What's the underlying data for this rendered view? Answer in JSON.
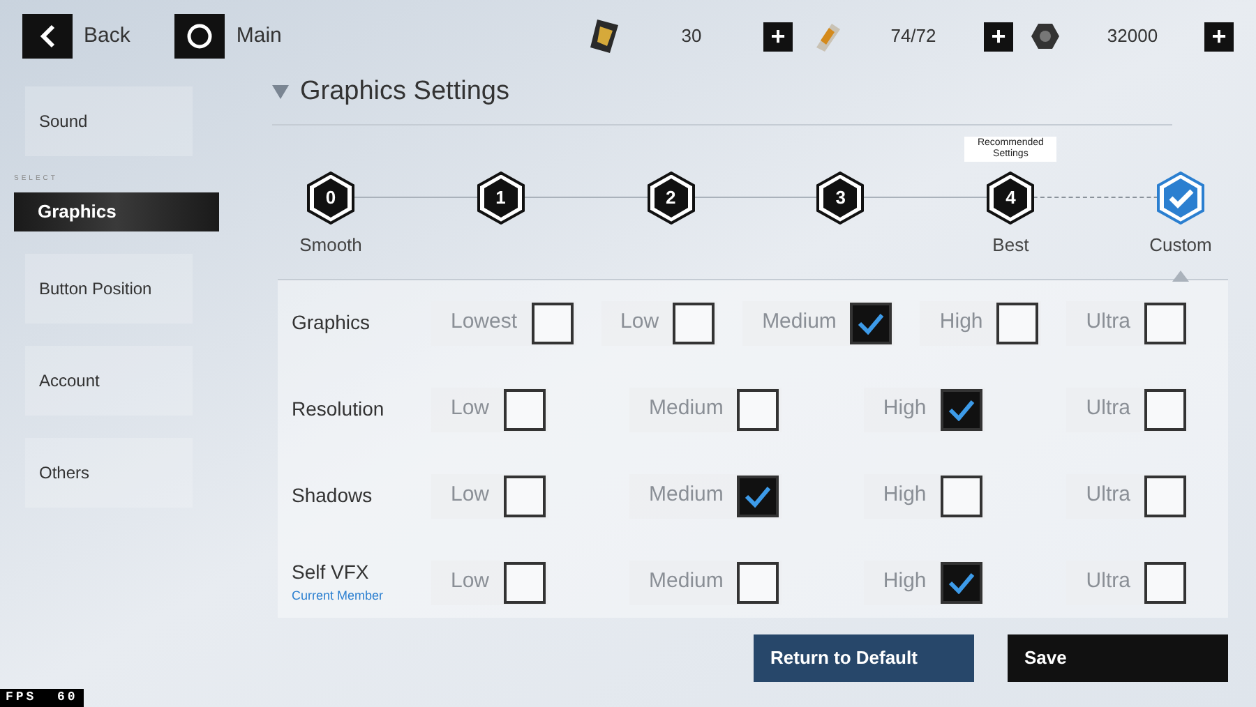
{
  "top_bar": {
    "back": "Back",
    "main": "Main",
    "currencies": [
      {
        "kind": "ticket",
        "value": "30",
        "add": "+"
      },
      {
        "kind": "canister",
        "value": "74/72",
        "add": "+"
      },
      {
        "kind": "nut",
        "value": "32000",
        "add": "+"
      }
    ]
  },
  "sidebar": {
    "select_label": "SELECT",
    "items": [
      {
        "label": "Sound",
        "selected": false
      },
      {
        "label": "Graphics",
        "selected": true
      },
      {
        "label": "Button Position",
        "selected": false
      },
      {
        "label": "Account",
        "selected": false
      },
      {
        "label": "Others",
        "selected": false
      }
    ]
  },
  "section_title": "Graphics Settings",
  "presets": [
    {
      "number": "0",
      "label": "Smooth",
      "selected": false
    },
    {
      "number": "1",
      "selected": false
    },
    {
      "number": "2",
      "selected": false
    },
    {
      "number": "3",
      "selected": false
    },
    {
      "number": "4",
      "label": "Best",
      "tooltip": "Recommended Settings",
      "selected": false
    },
    {
      "label": "Custom",
      "selected": true
    }
  ],
  "settings": [
    {
      "label": "Graphics",
      "options": [
        {
          "label": "Lowest",
          "checked": false
        },
        {
          "label": "Low",
          "checked": false
        },
        {
          "label": "Medium",
          "checked": true
        },
        {
          "label": "High",
          "checked": false
        },
        {
          "label": "Ultra",
          "checked": false
        }
      ]
    },
    {
      "label": "Resolution",
      "options": [
        {
          "label": "Low",
          "checked": false
        },
        {
          "label": "Medium",
          "checked": false
        },
        {
          "label": "High",
          "checked": true
        },
        {
          "label": "Ultra",
          "checked": false
        }
      ]
    },
    {
      "label": "Shadows",
      "options": [
        {
          "label": "Low",
          "checked": false
        },
        {
          "label": "Medium",
          "checked": true
        },
        {
          "label": "High",
          "checked": false
        },
        {
          "label": "Ultra",
          "checked": false
        }
      ]
    },
    {
      "label": "Self VFX",
      "note": "Current Member",
      "options": [
        {
          "label": "Low",
          "checked": false
        },
        {
          "label": "Medium",
          "checked": false
        },
        {
          "label": "High",
          "checked": true
        },
        {
          "label": "Ultra",
          "checked": false
        }
      ]
    }
  ],
  "buttons": [
    {
      "label": "Return to Default",
      "kind": "secondary"
    },
    {
      "label": "Save",
      "kind": "primary"
    }
  ],
  "fps": "FPS  60"
}
